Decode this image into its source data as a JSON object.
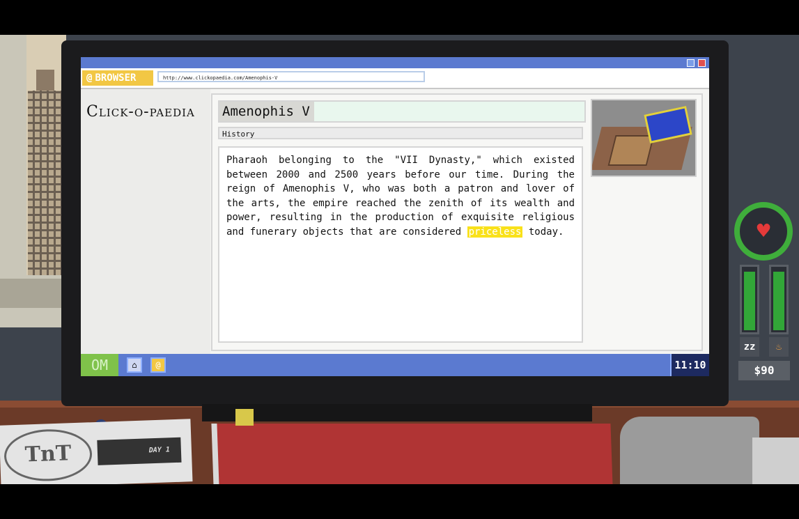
{
  "browser": {
    "label": "BROWSER",
    "url": "http://www.clickopaedia.com/Amenophis-V",
    "site_logo": "Click-o-paedia"
  },
  "article": {
    "title": "Amenophis V",
    "category": "History",
    "body_before": "Pharaoh belonging to the \"VII Dynasty,\" which existed between 2000 and 2500 years before our time. During the reign of Amenophis V, who was both a patron and lover of the arts, the empire reached the zenith of its wealth and power, resulting in the production of exquisite religious and funerary objects that are considered ",
    "highlight": "priceless",
    "body_after": " today."
  },
  "taskbar": {
    "start_label": "OM",
    "clock": "11:10"
  },
  "hud": {
    "money": "$90",
    "sleep_icon": "zz",
    "food_icon": "drumstick-icon",
    "sleep_level": 0.95,
    "food_level": 0.95,
    "health_level": 0.9
  },
  "desk": {
    "paper_logo": "TnT",
    "paper_day": "DAY 1"
  },
  "colors": {
    "taskbar": "#5b7ad0",
    "browser_label": "#f2c744",
    "highlight": "#f9e11a",
    "health": "#3fae3b",
    "heart": "#e53a3a"
  }
}
